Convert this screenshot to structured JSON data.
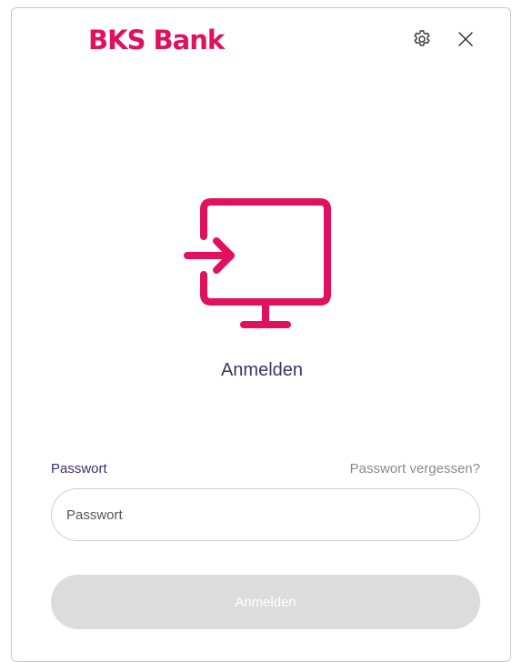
{
  "header": {
    "brand": "BKS Bank",
    "settings_icon": "gear-icon",
    "close_icon": "close-icon"
  },
  "colors": {
    "brand": "#e0115f",
    "heading": "#3d3563",
    "button_disabled": "#dcdcdc"
  },
  "hero": {
    "icon": "monitor-login-icon",
    "title": "Anmelden"
  },
  "form": {
    "password_label": "Passwort",
    "forgot_link": "Passwort vergessen?",
    "password_placeholder": "Passwort",
    "password_value": "",
    "submit_label": "Anmelden",
    "submit_enabled": false
  }
}
